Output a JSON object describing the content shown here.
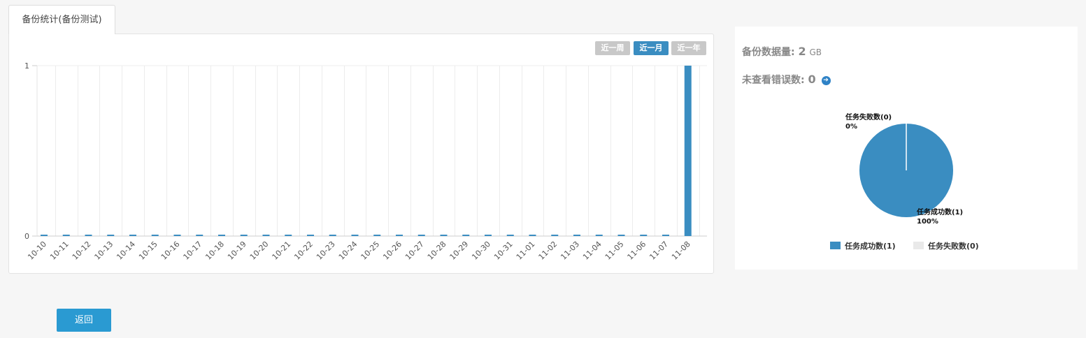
{
  "tab": {
    "label": "备份统计(备份测试)"
  },
  "range_buttons": [
    {
      "label": "近一周",
      "active": false
    },
    {
      "label": "近一月",
      "active": true
    },
    {
      "label": "近一年",
      "active": false
    }
  ],
  "summary": {
    "backup_size_label": "备份数据量:",
    "backup_size_value": "2",
    "backup_size_unit": "GB",
    "unviewed_errors_label": "未查看错误数:",
    "unviewed_errors_value": "0"
  },
  "pie": {
    "fail_label": "任务失败数(0)",
    "fail_pct": "0%",
    "success_label": "任务成功数(1)",
    "success_pct": "100%",
    "legend": [
      {
        "label": "任务成功数(1)",
        "color": "#3a8dc1"
      },
      {
        "label": "任务失败数(0)",
        "color": "#e9e9e9"
      }
    ]
  },
  "back_button": {
    "label": "返回"
  },
  "colors": {
    "accent": "#3a8dc1",
    "button": "#2a9ad2"
  },
  "chart_data": [
    {
      "type": "bar",
      "categories": [
        "10-10",
        "10-11",
        "10-12",
        "10-13",
        "10-14",
        "10-15",
        "10-16",
        "10-17",
        "10-18",
        "10-19",
        "10-20",
        "10-21",
        "10-22",
        "10-23",
        "10-24",
        "10-25",
        "10-26",
        "10-27",
        "10-28",
        "10-29",
        "10-30",
        "10-31",
        "11-01",
        "11-02",
        "11-03",
        "11-04",
        "11-05",
        "11-06",
        "11-07",
        "11-08"
      ],
      "values": [
        0,
        0,
        0,
        0,
        0,
        0,
        0,
        0,
        0,
        0,
        0,
        0,
        0,
        0,
        0,
        0,
        0,
        0,
        0,
        0,
        0,
        0,
        0,
        0,
        0,
        0,
        0,
        0,
        0,
        1
      ],
      "y_ticks": [
        0,
        1
      ],
      "ylim": [
        0,
        1
      ],
      "grid": true,
      "color": "#3a8dc1"
    },
    {
      "type": "pie",
      "categories": [
        "任务成功数(1)",
        "任务失败数(0)"
      ],
      "values": [
        1,
        0
      ],
      "colors": [
        "#3a8dc1",
        "#e9e9e9"
      ],
      "legend": "bottom"
    }
  ]
}
